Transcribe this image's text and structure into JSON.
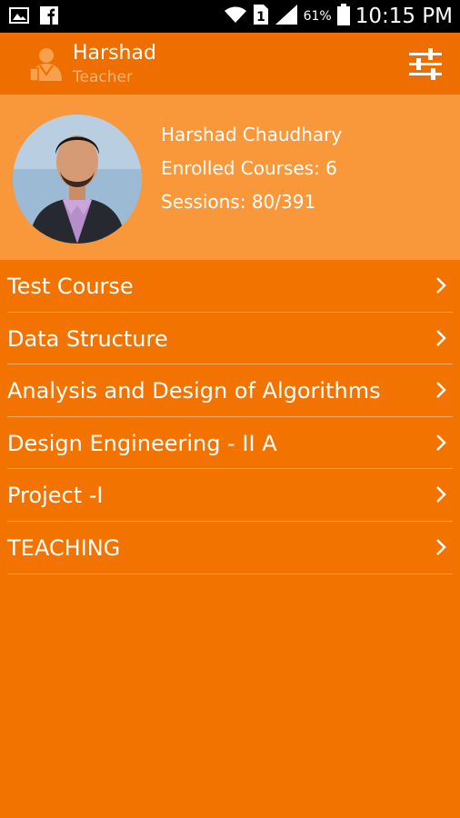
{
  "status_bar": {
    "time": "10:15 PM",
    "battery_percent": "61%",
    "icons": [
      "image-icon",
      "facebook-icon",
      "wifi-icon",
      "sim-icon",
      "signal-icon",
      "battery-icon"
    ]
  },
  "app_bar": {
    "title": "Harshad",
    "subtitle": "Teacher",
    "logo_icon": "teacher-avatar-icon",
    "action_icon": "settings-sliders-icon"
  },
  "profile": {
    "name": "Harshad Chaudhary",
    "enrolled_courses": "Enrolled Courses: 6",
    "sessions": "Sessions: 80/391"
  },
  "courses": [
    {
      "label": "Test Course"
    },
    {
      "label": "Data Structure"
    },
    {
      "label": "Analysis and Design of Algorithms"
    },
    {
      "label": "Design Engineering - II A"
    },
    {
      "label": "Project -I"
    },
    {
      "label": "TEACHING"
    }
  ],
  "colors": {
    "background": "#f27300",
    "app_bar": "#ee6f00",
    "profile_panel": "#f8983a",
    "subtitle": "#f7b47a"
  }
}
